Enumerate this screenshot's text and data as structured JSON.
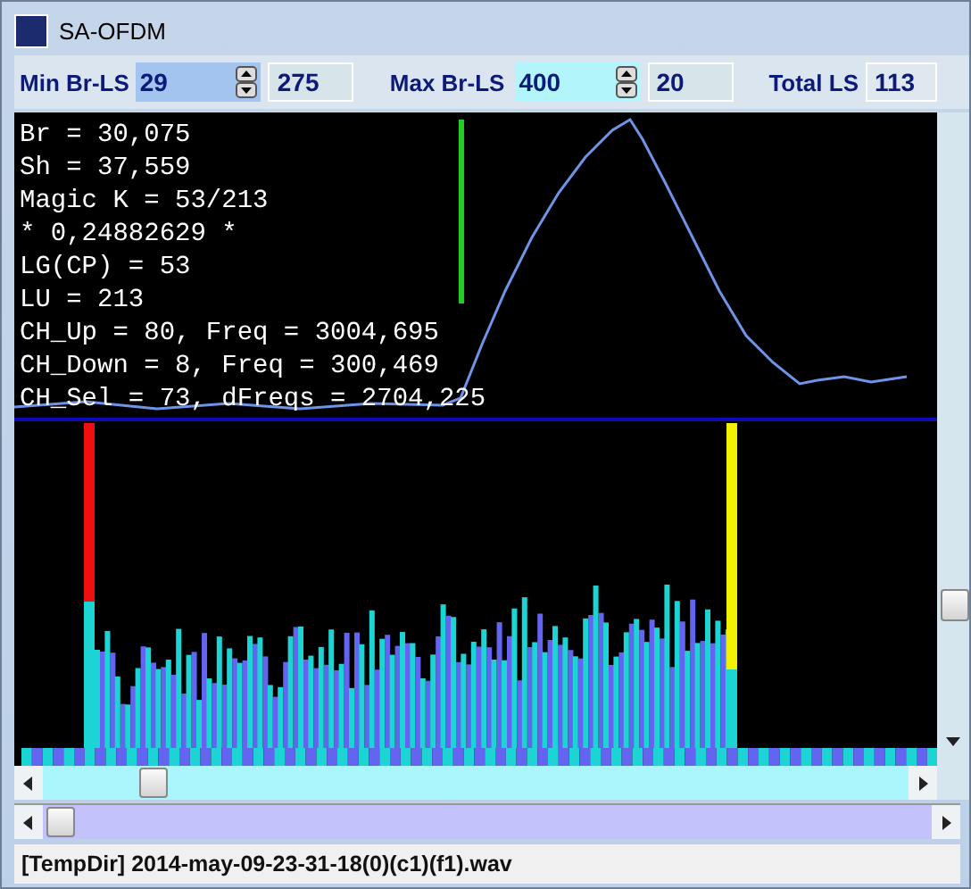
{
  "window": {
    "title": "SA-OFDM"
  },
  "toolbar": {
    "min_br_ls": {
      "label": "Min Br-LS",
      "value": "29",
      "readout": "275"
    },
    "max_br_ls": {
      "label": "Max Br-LS",
      "value": "400",
      "readout": "20"
    },
    "total_ls": {
      "label": "Total LS",
      "value": "113"
    }
  },
  "readout_lines": [
    "Br = 30,075",
    "Sh = 37,559",
    "Magic K = 53/213",
    "* 0,24882629 *",
    "LG(CP) = 53",
    "LU = 213",
    "CH_Up = 80, Freq = 3004,695",
    "CH_Down = 8, Freq = 300,469",
    "CH_Sel = 73, dFreqs = 2704,225"
  ],
  "status_bar": {
    "text": "[TempDir] 2014-may-09-23-31-18(0)(c1)(f1).wav"
  }
}
